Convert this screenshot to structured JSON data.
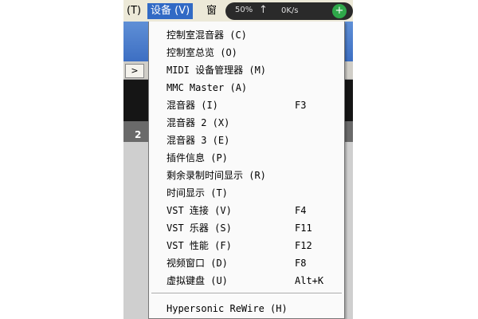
{
  "menubar": {
    "help_tail": "(T)",
    "devices": "设备 (V)",
    "window_fragment": "窗",
    "net_widget": {
      "percent": "50%",
      "arrow": "↑",
      "speed": "0K/s",
      "button": "+"
    }
  },
  "workspace": {
    "ruler_number": "2",
    "pill": ">"
  },
  "devices_menu": {
    "items": [
      {
        "label": "控制室混音器 (C)",
        "shortcut": ""
      },
      {
        "label": "控制室总览 (O)",
        "shortcut": ""
      },
      {
        "label": "MIDI 设备管理器 (M)",
        "shortcut": ""
      },
      {
        "label": "MMC Master (A)",
        "shortcut": ""
      },
      {
        "label": "混音器 (I)",
        "shortcut": "F3"
      },
      {
        "label": "混音器 2 (X)",
        "shortcut": ""
      },
      {
        "label": "混音器 3 (E)",
        "shortcut": ""
      },
      {
        "label": "插件信息 (P)",
        "shortcut": ""
      },
      {
        "label": "剩余录制时间显示 (R)",
        "shortcut": ""
      },
      {
        "label": "时间显示 (T)",
        "shortcut": ""
      },
      {
        "label": "VST 连接 (V)",
        "shortcut": "F4"
      },
      {
        "label": "VST 乐器 (S)",
        "shortcut": "F11"
      },
      {
        "label": "VST 性能 (F)",
        "shortcut": "F12"
      },
      {
        "label": "视频窗口 (D)",
        "shortcut": "F8"
      },
      {
        "label": "虚拟键盘 (U)",
        "shortcut": "Alt+K"
      },
      {
        "label": "Hypersonic ReWire (H)",
        "shortcut": ""
      }
    ]
  }
}
